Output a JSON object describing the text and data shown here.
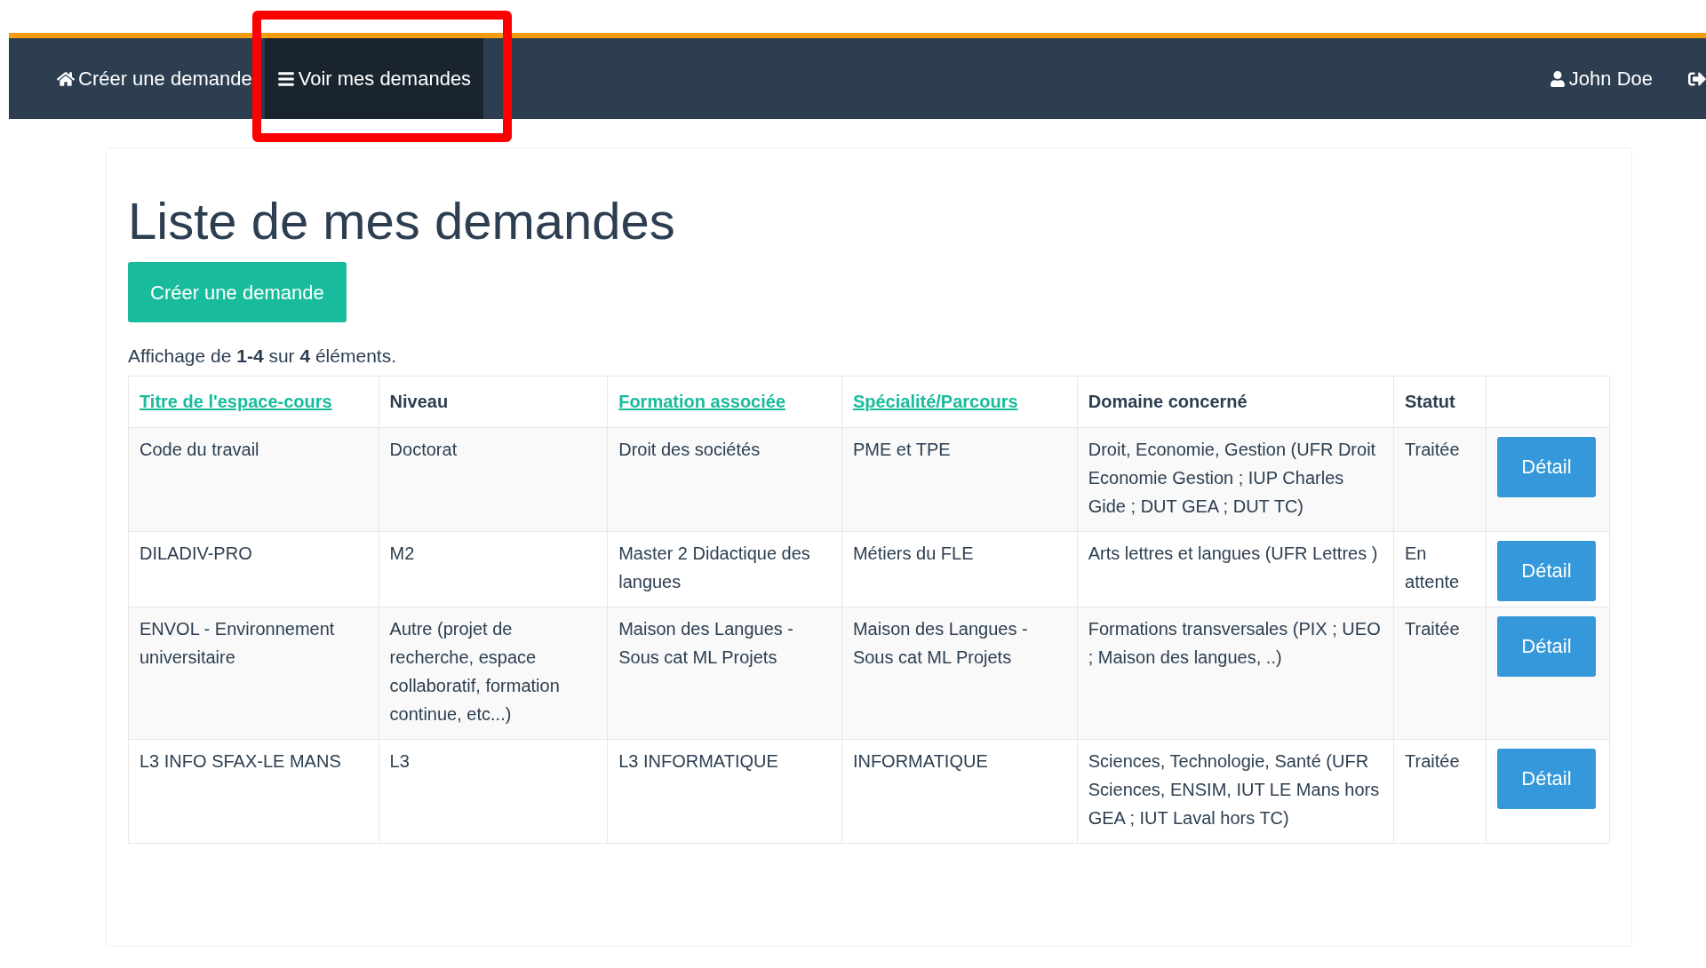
{
  "navbar": {
    "items": [
      {
        "label": "Créer une demande",
        "kind": "home",
        "selected": false,
        "highlighted": false
      },
      {
        "label": "Voir mes demandes",
        "kind": "list",
        "selected": true,
        "highlighted": true
      }
    ],
    "user": "John Doe"
  },
  "page": {
    "title": "Liste de mes demandes",
    "create_button": "Créer une demande",
    "summary": "Affichage de **1-4** sur **4** éléments."
  },
  "table": {
    "columns": [
      {
        "label": "Titre de l'espace-cours",
        "sortable": true
      },
      {
        "label": "Niveau",
        "sortable": false
      },
      {
        "label": "Formation associée",
        "sortable": true
      },
      {
        "label": "Spécialité/Parcours",
        "sortable": true
      },
      {
        "label": "Domaine concerné",
        "sortable": false
      },
      {
        "label": "Statut",
        "sortable": false
      }
    ],
    "rows": [
      {
        "cells": [
          "Code du travail",
          "Doctorat",
          "Droit des sociétés",
          "PME et TPE",
          "Droit, Economie, Gestion (UFR Droit Economie Gestion ; IUP Charles Gide ; DUT GEA ; DUT TC)",
          "Traitée"
        ],
        "action": "Détail"
      },
      {
        "cells": [
          "DILADIV-PRO",
          "M2",
          "Master 2 Didactique des langues",
          "Métiers du FLE",
          "Arts lettres et langues (UFR Lettres )",
          "En attente"
        ],
        "action": "Détail"
      },
      {
        "cells": [
          "ENVOL - Environnement universitaire",
          "Autre (projet de recherche, espace collaboratif, formation continue, etc...)",
          "Maison des Langues - Sous cat ML Projets",
          "Maison des Langues - Sous cat ML Projets",
          "Formations transversales (PIX ; UEO ; Maison des langues, ..)",
          "Traitée"
        ],
        "action": "Détail"
      },
      {
        "cells": [
          "L3 INFO SFAX-LE MANS",
          "L3",
          "L3 INFORMATIQUE",
          "INFORMATIQUE",
          "Sciences, Technologie, Santé (UFR Sciences, ENSIM, IUT LE Mans hors GEA ; IUT Laval hors TC)",
          "Traitée"
        ],
        "action": "Détail"
      }
    ]
  }
}
